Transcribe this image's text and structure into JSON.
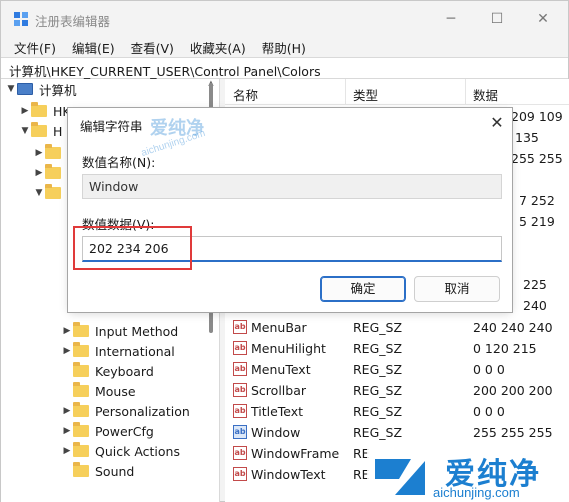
{
  "window": {
    "title": "注册表编辑器",
    "minimize_glyph": "─",
    "maximize_glyph": "☐",
    "close_glyph": "✕"
  },
  "menu": [
    "文件(F)",
    "编辑(E)",
    "查看(V)",
    "收藏夹(A)",
    "帮助(H)"
  ],
  "address": "计算机\\HKEY_CURRENT_USER\\Control Panel\\Colors",
  "tree": {
    "root": "计算机",
    "hkcr": "HKEY_CLASSES_ROOT",
    "hkcu_prefix": "H",
    "items": [
      "Input Method",
      "International",
      "Keyboard",
      "Mouse",
      "Personalization",
      "PowerCfg",
      "Quick Actions",
      "Sound"
    ]
  },
  "list": {
    "headers": {
      "name": "名称",
      "type": "类型",
      "data": "数据"
    },
    "partial_values": [
      "209 109",
      "135",
      "255 255",
      "7 252",
      "5 219",
      "225",
      "240"
    ],
    "rows": [
      {
        "name": "MenuBar",
        "type": "REG_SZ",
        "data": "240 240 240"
      },
      {
        "name": "MenuHilight",
        "type": "REG_SZ",
        "data": "0 120 215"
      },
      {
        "name": "MenuText",
        "type": "REG_SZ",
        "data": "0 0 0"
      },
      {
        "name": "Scrollbar",
        "type": "REG_SZ",
        "data": "200 200 200"
      },
      {
        "name": "TitleText",
        "type": "REG_SZ",
        "data": "0 0 0"
      },
      {
        "name": "Window",
        "type": "REG_SZ",
        "data": "255 255 255"
      },
      {
        "name": "WindowFrame",
        "type": "RE",
        "data": ""
      },
      {
        "name": "WindowText",
        "type": "RE",
        "data": ""
      }
    ]
  },
  "dialog": {
    "title": "编辑字符串",
    "close_glyph": "✕",
    "name_label": "数值名称(N):",
    "name_value": "Window",
    "data_label": "数值数据(V):",
    "data_value": "202 234 206",
    "ok": "确定",
    "cancel": "取消"
  },
  "watermark": {
    "brand_cn": "爱纯净",
    "brand_url": "aichunjing.com"
  },
  "colors": {
    "accent": "#2b6fc7",
    "highlight": "#e03a3a",
    "folder": "#f6cf5b",
    "watermark": "#1c7fd0"
  }
}
